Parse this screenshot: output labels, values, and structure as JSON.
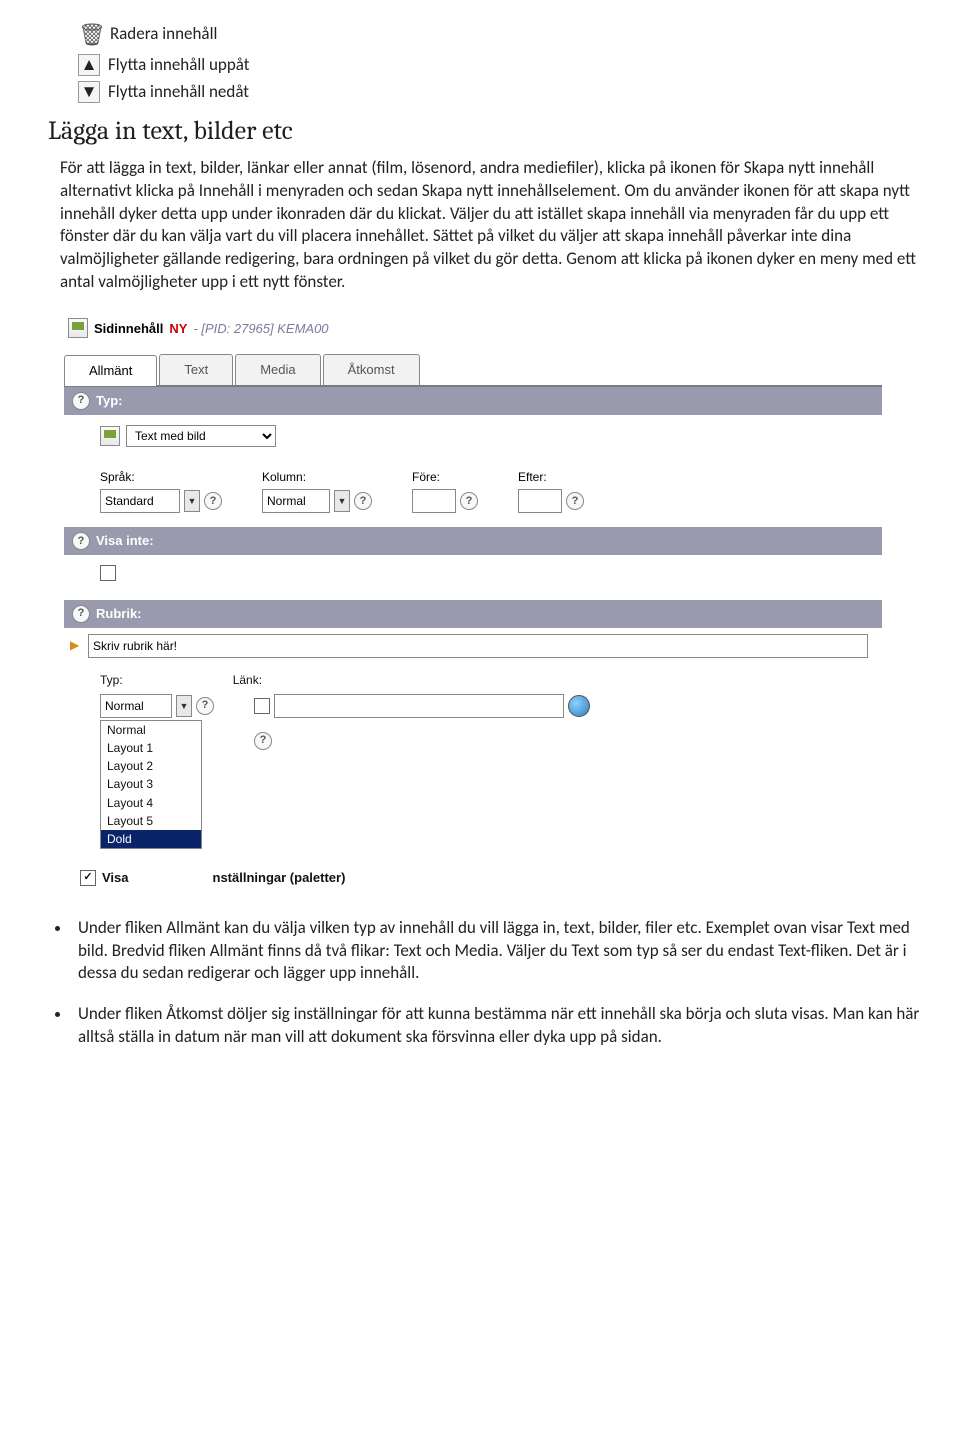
{
  "actions": [
    {
      "name": "delete-icon",
      "label": "Radera innehåll"
    },
    {
      "name": "move-up-icon",
      "label": "Flytta innehåll uppåt"
    },
    {
      "name": "move-down-icon",
      "label": "Flytta innehåll nedåt"
    }
  ],
  "doc": {
    "heading": "Lägga in text, bilder etc",
    "para": "För att lägga in text, bilder, länkar eller annat (film, lösenord, andra mediefiler), klicka på ikonen för Skapa nytt innehåll alternativt klicka på Innehåll i menyraden och sedan Skapa nytt innehållselement. Om du använder ikonen för att skapa nytt innehåll dyker detta upp under ikonraden där du klickat. Väljer du att istället skapa innehåll via menyraden får du upp ett fönster där du kan välja vart du vill placera innehållet. Sättet på vilket du väljer att skapa innehåll påverkar inte dina valmöjligheter gällande redigering, bara ordningen på vilket du gör detta. Genom att klicka på ikonen dyker en meny med ett antal valmöjligheter upp i ett nytt fönster.",
    "bullets": [
      "Under fliken Allmänt kan du välja vilken typ av innehåll du vill lägga in, text, bilder, filer etc. Exemplet ovan visar Text med bild. Bredvid fliken Allmänt finns då två flikar: Text och Media. Väljer du Text som typ så ser du endast Text-fliken. Det är i dessa du sedan redigerar och lägger upp innehåll.",
      "Under fliken Åtkomst döljer sig inställningar för att kunna bestämma när ett innehåll ska börja och sluta visas. Man kan här alltså ställa in datum när man vill att dokument ska försvinna eller dyka upp på sidan."
    ]
  },
  "panel": {
    "title_strong": "Sidinnehåll",
    "title_red": "NY",
    "title_grey": "- [PID: 27965] KEMA00",
    "tabs": [
      "Allmänt",
      "Text",
      "Media",
      "Åtkomst"
    ],
    "typ_label": "Typ:",
    "typ_value": "Text med bild",
    "fields": {
      "sprak": {
        "label": "Språk:",
        "value": "Standard"
      },
      "kolumn": {
        "label": "Kolumn:",
        "value": "Normal"
      },
      "fore": {
        "label": "Före:",
        "value": ""
      },
      "efter": {
        "label": "Efter:",
        "value": ""
      }
    },
    "visa_inte_label": "Visa inte:",
    "rubrik_label": "Rubrik:",
    "rubrik_value": "Skriv rubrik här!",
    "sub_typ_label": "Typ:",
    "lank_label": "Länk:",
    "type_options": [
      "Normal",
      "Layout 1",
      "Layout 2",
      "Layout 3",
      "Layout 4",
      "Layout 5",
      "Dold"
    ],
    "type_selected": "Dold",
    "palette_prefix": "Visa",
    "palette_suffix": "nställningar (paletter)"
  }
}
